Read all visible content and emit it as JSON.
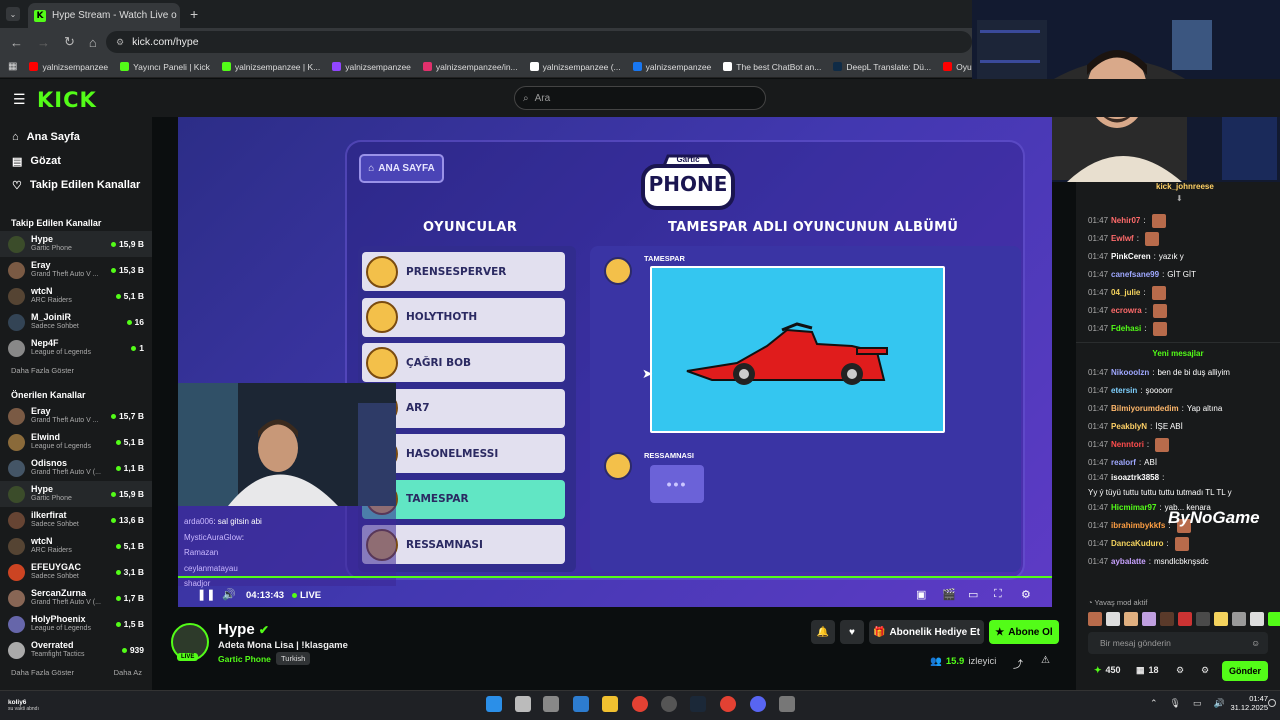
{
  "browser": {
    "tab_title": "Hype Stream - Watch Live o",
    "url": "kick.com/hype",
    "bookmarks": [
      {
        "label": "yalnizsempanzee",
        "color": "#ff0000"
      },
      {
        "label": "Yayıncı Paneli | Kick",
        "color": "#53fc18"
      },
      {
        "label": "yalnizsempanzee | K...",
        "color": "#53fc18"
      },
      {
        "label": "yalnizsempanzee",
        "color": "#9146ff"
      },
      {
        "label": "yalnizsempanzee/in...",
        "color": "#e1306c"
      },
      {
        "label": "yalnizsempanzee (...",
        "color": "#ffffff"
      },
      {
        "label": "yalnizsempanzee",
        "color": "#1877f2"
      },
      {
        "label": "The best ChatBot an...",
        "color": "#ffffff"
      },
      {
        "label": "DeepL Translate: Dü...",
        "color": "#0f2b46"
      },
      {
        "label": "Oyunlara YAPAY",
        "color": "#ff0000"
      }
    ]
  },
  "header": {
    "logo": "KICK",
    "search_placeholder": "Ara"
  },
  "sidebar": {
    "nav": [
      {
        "label": "Ana Sayfa",
        "icon": "home-icon"
      },
      {
        "label": "Gözat",
        "icon": "browse-icon"
      },
      {
        "label": "Takip Edilen Kanallar",
        "icon": "heart-icon"
      }
    ],
    "followed_title": "Takip Edilen Kanallar",
    "followed": [
      {
        "name": "Hype",
        "game": "Gartic Phone",
        "viewers": "15,9 B",
        "color": "#3b4c2a",
        "active": true
      },
      {
        "name": "Eray",
        "game": "Grand Theft Auto V ...",
        "viewers": "15,3 B",
        "color": "#7a5a44"
      },
      {
        "name": "wtcN",
        "game": "ARC Raiders",
        "viewers": "5,1 B",
        "color": "#554433"
      },
      {
        "name": "M_JoiniR",
        "game": "Sadece Sohbet",
        "viewers": "16",
        "color": "#334455"
      },
      {
        "name": "Nep4F",
        "game": "League of Legends",
        "viewers": "1",
        "color": "#888888"
      }
    ],
    "followed_more": "Daha Fazla Göster",
    "recommended_title": "Önerilen Kanallar",
    "recommended": [
      {
        "name": "Eray",
        "game": "Grand Theft Auto V ...",
        "viewers": "15,7 B",
        "color": "#7a5a44"
      },
      {
        "name": "Elwind",
        "game": "League of Legends",
        "viewers": "5,1 B",
        "color": "#8a6a3a"
      },
      {
        "name": "Odisnos",
        "game": "Grand Theft Auto V (...",
        "viewers": "1,1 B",
        "color": "#445566"
      },
      {
        "name": "Hype",
        "game": "Gartic Phone",
        "viewers": "15,9 B",
        "color": "#3b4c2a",
        "active": true
      },
      {
        "name": "ilkerfirat",
        "game": "Sadece Sohbet",
        "viewers": "13,6 B",
        "color": "#664433"
      },
      {
        "name": "wtcN",
        "game": "ARC Raiders",
        "viewers": "5,1 B",
        "color": "#554433"
      },
      {
        "name": "EFEUYGAC",
        "game": "Sadece Sohbet",
        "viewers": "3,1 B",
        "color": "#cc4422"
      },
      {
        "name": "SercanZurna",
        "game": "Grand Theft Auto V (...",
        "viewers": "1,7 B",
        "color": "#886655"
      },
      {
        "name": "HolyPhoenix",
        "game": "League of Legends",
        "viewers": "1,5 B",
        "color": "#6666aa"
      },
      {
        "name": "Overrated",
        "game": "Teamfight Tactics",
        "viewers": "939",
        "color": "#aaaaaa"
      }
    ],
    "rec_more": "Daha Fazla Göster",
    "rec_less": "Daha Az"
  },
  "game": {
    "home_label": "ANA SAYFA",
    "logo_top": "Gartic",
    "logo_bottom": "PHONE",
    "players_title": "OYUNCULAR",
    "album_title": "TAMESPAR ADLI OYUNCUNUN ALBÜMÜ",
    "players": [
      {
        "name": "PRENSESPERVER"
      },
      {
        "name": "HOLYTHOTH"
      },
      {
        "name": "ÇAĞRI BOB"
      },
      {
        "name": "AR7"
      },
      {
        "name": "HASONELMESSI"
      },
      {
        "name": "TAMESPAR",
        "selected": true
      },
      {
        "name": "RESSAMNASI"
      }
    ],
    "album_author": "TAMESPAR",
    "next_player": "RESSAMNASI",
    "typing": "•••"
  },
  "mini_chat": [
    {
      "user": "arda006",
      "text": ": sal gitsin abi"
    },
    {
      "user": "MysticAuraGlow",
      "text": ":"
    },
    {
      "user": "Ramazan",
      "text": ""
    },
    {
      "user": "ceylanmatayau",
      "text": ""
    },
    {
      "user": "shadjor",
      "text": ""
    }
  ],
  "player": {
    "time": "04:13:43",
    "live": "LIVE"
  },
  "stream": {
    "name": "Hype",
    "title": "Adeta Mona Lisa | !klasgame",
    "category": "Gartic Phone",
    "language": "Turkish",
    "live_badge": "LIVE",
    "gift_label": "Abonelik Hediye Et",
    "sub_label": "Abone Ol",
    "viewers": "15.9",
    "viewers_label": "izleyici"
  },
  "webcam": {
    "top_user": "kick_johnreese"
  },
  "chat": {
    "messages_top": [
      {
        "time": "01:47",
        "user": "Nehir07",
        "color": "#ff6b6b",
        "text": ""
      },
      {
        "time": "01:47",
        "user": "Ewlwf",
        "color": "#ff6b6b",
        "text": ""
      },
      {
        "time": "01:47",
        "user": "PinkCeren",
        "color": "#ffffff",
        "text": "yazık y"
      },
      {
        "time": "01:47",
        "user": "canefsane99",
        "color": "#9fa8ff",
        "text": "GİT GİT"
      },
      {
        "time": "01:47",
        "user": "04_julie",
        "color": "#f4d35e",
        "text": ""
      },
      {
        "time": "01:47",
        "user": "ecrowra",
        "color": "#ff6b6b",
        "text": ""
      },
      {
        "time": "01:47",
        "user": "Fdehasi",
        "color": "#53fc18",
        "text": ""
      }
    ],
    "new_messages": "Yeni mesajlar",
    "messages": [
      {
        "time": "01:47",
        "user": "Nikooolzn",
        "color": "#9fa8ff",
        "text": "ben de bi duş alliyim"
      },
      {
        "time": "01:47",
        "user": "etersin",
        "color": "#7fd1ff",
        "text": "şoooorr"
      },
      {
        "time": "01:47",
        "user": "Bilmiyorumdedim",
        "color": "#ffb86b",
        "text": "Yap altına"
      },
      {
        "time": "01:47",
        "user": "PeakblyN",
        "color": "#ffd166",
        "text": "İŞE ABİ"
      },
      {
        "time": "01:47",
        "user": "Nenntori",
        "color": "#ff4d4d",
        "text": ""
      },
      {
        "time": "01:47",
        "user": "realorf",
        "color": "#9fa8ff",
        "text": "ABİ"
      },
      {
        "time": "01:47",
        "user": "isoaztrk3858",
        "color": "#ffffff",
        "text": "Yy ý tüyü tuttu tuttu tuttu tutmadı TL TL y"
      },
      {
        "time": "01:47",
        "user": "Hicmimar97",
        "color": "#53fc18",
        "text": "yab... kenara"
      },
      {
        "time": "01:47",
        "user": "ibrahimbykkfs",
        "color": "#ff9f43",
        "text": ""
      },
      {
        "time": "01:47",
        "user": "DancaKuduro",
        "color": "#f4d35e",
        "text": ""
      },
      {
        "time": "01:47",
        "user": "aybalatte",
        "color": "#c8a2ff",
        "text": "msndlcbknşsdc"
      }
    ],
    "watermark": "ByNoGame",
    "slow_mode": "Yavaş mod aktif",
    "input_placeholder": "Bir mesaj gönderin",
    "points": "450",
    "count": "18",
    "send_label": "Gönder"
  },
  "taskbar": {
    "profile_name": "koliy6",
    "profile_sub": "su vakti abndı",
    "time": "01:47",
    "date": "31.12.2025"
  }
}
